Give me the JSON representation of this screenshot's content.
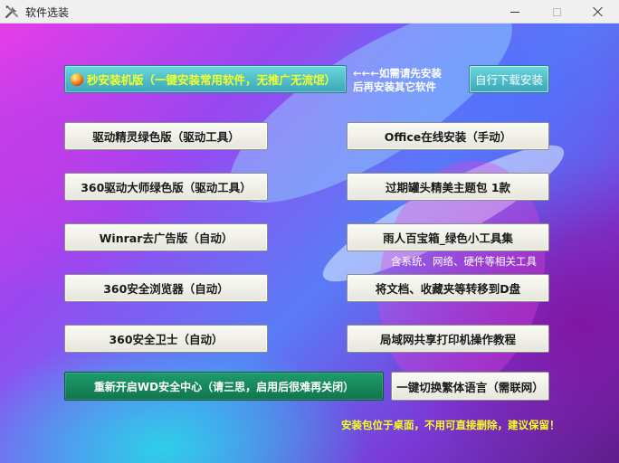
{
  "window": {
    "title": "软件选装",
    "icon": "tools-icon"
  },
  "top": {
    "quick_install_label": "秒安装机版（一键安装常用软件，无推广无流氓）",
    "hint_line1": "←←←如需请先安装",
    "hint_line2": "后再安装其它软件",
    "self_download_label": "自行下载安装"
  },
  "left_buttons": [
    {
      "label": "驱动精灵绿色版（驱动工具）"
    },
    {
      "label": "360驱动大师绿色版（驱动工具）"
    },
    {
      "label": "Winrar去广告版（自动）"
    },
    {
      "label": "360安全浏览器（自动）"
    },
    {
      "label": "360安全卫士（自动）"
    }
  ],
  "right_buttons": [
    {
      "label": "Office在线安装（手动）"
    },
    {
      "label": "过期罐头精美主题包 1款"
    },
    {
      "label": "雨人百宝箱_绿色小工具集"
    },
    {
      "label": "将文档、收藏夹等转移到D盘"
    },
    {
      "label": "局域网共享打印机操作教程"
    }
  ],
  "toolbox_hint": "含系统、网络、硬件等相关工具",
  "bottom": {
    "wd_button_label": "重新开启WD安全中心（请三思，启用后很难再关闭）",
    "traditional_button_label": "一键切换繁体语言（需联网）",
    "note": "安装包位于桌面，不用可直接删除，建议保留！"
  },
  "colors": {
    "accent_teal": "#3aa6b8",
    "quick_text": "#f2ff2a",
    "wd_green": "#11754e",
    "note_yellow": "#f6ff1e"
  }
}
